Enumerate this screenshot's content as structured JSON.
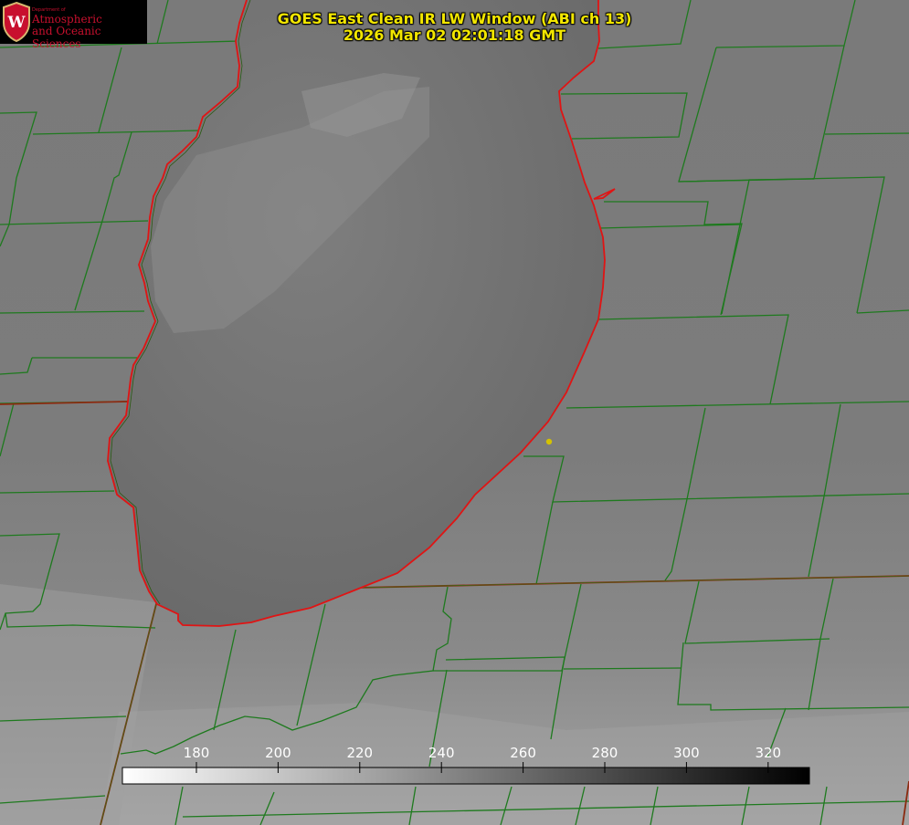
{
  "title": {
    "line1": "GOES East Clean IR LW Window (ABI ch 13)",
    "line2": "2026 Mar 02 02:01:18 GMT"
  },
  "logo": {
    "dept_line": "Department of",
    "org_line1": "Atmospheric",
    "org_line2": "and Oceanic Sciences",
    "emblem_letter": "W"
  },
  "colorbar": {
    "ticks": [
      {
        "value": "180"
      },
      {
        "value": "200"
      },
      {
        "value": "220"
      },
      {
        "value": "240"
      },
      {
        "value": "260"
      },
      {
        "value": "280"
      },
      {
        "value": "300"
      },
      {
        "value": "320"
      }
    ],
    "gradient_start": "#ffffff",
    "gradient_end": "#000000"
  },
  "colors": {
    "county_lines": "#1e7a1e",
    "shoreline": "#e01414",
    "title_text": "#f2e600",
    "marker": "#d4c200",
    "logo_red": "#c8102e"
  }
}
